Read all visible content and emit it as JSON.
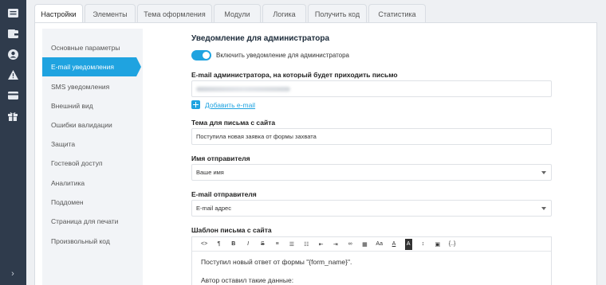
{
  "rail": {
    "icons": [
      "list-icon",
      "wallet-icon",
      "user-circle-icon",
      "warning-icon",
      "credit-card-icon",
      "gift-icon"
    ],
    "expand_glyph": "›"
  },
  "tabs": [
    {
      "label": "Настройки",
      "active": true
    },
    {
      "label": "Элементы",
      "active": false
    },
    {
      "label": "Тема оформления",
      "active": false
    },
    {
      "label": "Модули",
      "active": false
    },
    {
      "label": "Логика",
      "active": false
    },
    {
      "label": "Получить код",
      "active": false
    },
    {
      "label": "Статистика",
      "active": false
    }
  ],
  "sidebar": {
    "items": [
      {
        "label": "Основные параметры",
        "active": false
      },
      {
        "label": "E-mail уведомления",
        "active": true
      },
      {
        "label": "SMS уведомления",
        "active": false
      },
      {
        "label": "Внешний вид",
        "active": false
      },
      {
        "label": "Ошибки валидации",
        "active": false
      },
      {
        "label": "Защита",
        "active": false
      },
      {
        "label": "Гостевой доступ",
        "active": false
      },
      {
        "label": "Аналитика",
        "active": false
      },
      {
        "label": "Поддомен",
        "active": false
      },
      {
        "label": "Страница для печати",
        "active": false
      },
      {
        "label": "Произвольный код",
        "active": false
      }
    ]
  },
  "form": {
    "section_title": "Уведомление для администратора",
    "toggle": {
      "label": "Включить уведомление для администратора",
      "on": true
    },
    "admin_email": {
      "label": "E-mail администратора, на который будет приходить письмо"
    },
    "add_email_label": "Добавить e-mail",
    "subject": {
      "label": "Тема для письма с сайта",
      "value": "Поступила новая заявка от формы захвата"
    },
    "sender_name": {
      "label": "Имя отправителя",
      "value": "Ваше имя"
    },
    "sender_email": {
      "label": "E-mail отправителя",
      "value": "E-mail адрес"
    },
    "template": {
      "label": "Шаблон письма с сайта",
      "toolbar": [
        {
          "name": "code-view-icon",
          "glyph": "<>"
        },
        {
          "name": "paragraph-icon",
          "glyph": "¶"
        },
        {
          "name": "bold-icon",
          "glyph": "B"
        },
        {
          "name": "italic-icon",
          "glyph": "I"
        },
        {
          "name": "strikethrough-icon",
          "glyph": "S"
        },
        {
          "name": "align-left-icon",
          "glyph": "≡"
        },
        {
          "name": "bullet-list-icon",
          "glyph": "☰"
        },
        {
          "name": "numbered-list-icon",
          "glyph": "☷"
        },
        {
          "name": "outdent-icon",
          "glyph": "⇤"
        },
        {
          "name": "indent-icon",
          "glyph": "⇥"
        },
        {
          "name": "link-icon",
          "glyph": "∞"
        },
        {
          "name": "table-icon",
          "glyph": "▦"
        },
        {
          "name": "font-size-icon",
          "glyph": "Aa"
        },
        {
          "name": "font-color-icon",
          "glyph": "A"
        },
        {
          "name": "background-color-icon",
          "glyph": "A"
        },
        {
          "name": "line-height-icon",
          "glyph": "↕"
        },
        {
          "name": "image-icon",
          "glyph": "▣"
        },
        {
          "name": "variables-icon",
          "glyph": "{..}"
        }
      ],
      "lines": [
        "Поступил новый ответ от формы \"{form_name}\".",
        "Автор оставил такие данные:"
      ]
    }
  },
  "colors": {
    "accent": "#1fa3e0",
    "rail": "#2f3b4c",
    "sidebar": "#f2f4f7"
  }
}
